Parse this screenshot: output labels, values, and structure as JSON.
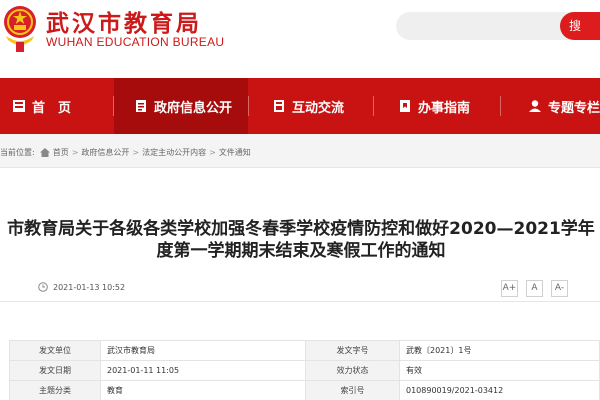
{
  "header": {
    "title": "武汉市教育局",
    "subtitle": "WUHAN EDUCATION BUREAU",
    "search_button": "搜"
  },
  "nav": [
    {
      "label": "首　页",
      "icon": "home-icon"
    },
    {
      "label": "政府信息公开",
      "icon": "document-icon",
      "active": true
    },
    {
      "label": "互动交流",
      "icon": "chat-icon"
    },
    {
      "label": "办事指南",
      "icon": "bookmark-icon"
    },
    {
      "label": "专题专栏",
      "icon": "person-icon"
    }
  ],
  "breadcrumb": {
    "prefix": "当前位置:",
    "items": [
      "首页",
      "政府信息公开",
      "法定主动公开内容",
      "文件通知"
    ],
    "separator": ">"
  },
  "article": {
    "title_line1": "市教育局关于各级各类学校加强冬春季学校疫情防控和做好2020—2021学年",
    "title_line2": "度第一学期期末结束及寒假工作的通知",
    "publish_time": "2021-01-13 10:52",
    "font_buttons": [
      "A+",
      "A",
      "A-"
    ]
  },
  "info_table": [
    {
      "label1": "发文单位",
      "value1": "武汉市教育局",
      "label2": "发文字号",
      "value2": "武教〔2021〕1号"
    },
    {
      "label1": "发文日期",
      "value1": "2021-01-11 11:05",
      "label2": "效力状态",
      "value2": "有效"
    },
    {
      "label1": "主题分类",
      "value1": "教育",
      "label2": "索引号",
      "value2": "010890019/2021-03412"
    }
  ],
  "colors": {
    "brand_red": "#c91313",
    "nav_active": "#a70c0c",
    "search_red": "#dd1d1d"
  }
}
